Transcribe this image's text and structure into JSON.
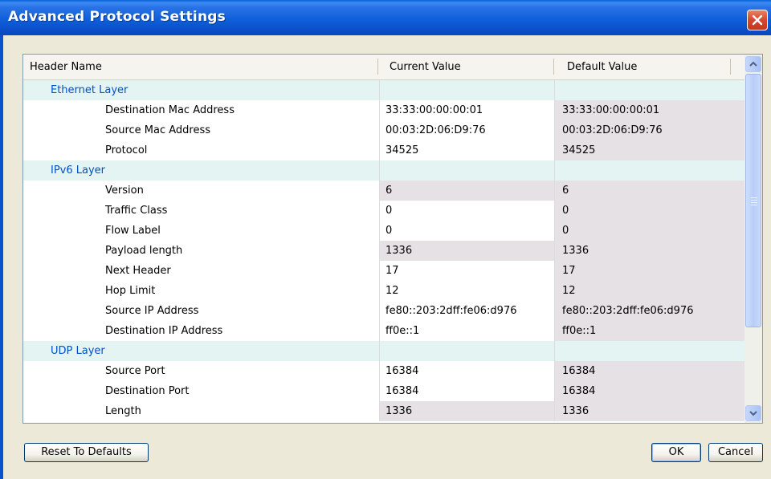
{
  "window": {
    "title": "Advanced Protocol Settings"
  },
  "grid": {
    "headers": [
      "Header Name",
      "Current Value",
      "Default Value"
    ],
    "rows": [
      {
        "section": true,
        "name": "Ethernet Layer",
        "current": "",
        "default": ""
      },
      {
        "section": false,
        "name": "Destination Mac Address",
        "current": "33:33:00:00:00:01",
        "default": "33:33:00:00:00:01"
      },
      {
        "section": false,
        "name": "Source Mac Address",
        "current": "00:03:2D:06:D9:76",
        "default": "00:03:2D:06:D9:76"
      },
      {
        "section": false,
        "name": "Protocol",
        "current": "34525",
        "default": "34525"
      },
      {
        "section": true,
        "name": "IPv6 Layer",
        "current": "",
        "default": ""
      },
      {
        "section": false,
        "name": "Version",
        "current": "6",
        "default": "6",
        "readonly": true
      },
      {
        "section": false,
        "name": "Traffic Class",
        "current": "0",
        "default": "0"
      },
      {
        "section": false,
        "name": "Flow Label",
        "current": "0",
        "default": "0"
      },
      {
        "section": false,
        "name": "Payload length",
        "current": "1336",
        "default": "1336",
        "readonly": true
      },
      {
        "section": false,
        "name": "Next Header",
        "current": "17",
        "default": "17"
      },
      {
        "section": false,
        "name": "Hop Limit",
        "current": "12",
        "default": "12"
      },
      {
        "section": false,
        "name": "Source IP Address",
        "current": "fe80::203:2dff:fe06:d976",
        "default": "fe80::203:2dff:fe06:d976"
      },
      {
        "section": false,
        "name": "Destination IP Address",
        "current": "ff0e::1",
        "default": "ff0e::1"
      },
      {
        "section": true,
        "name": "UDP Layer",
        "current": "",
        "default": ""
      },
      {
        "section": false,
        "name": "Source Port",
        "current": "16384",
        "default": "16384"
      },
      {
        "section": false,
        "name": "Destination Port",
        "current": "16384",
        "default": "16384"
      },
      {
        "section": false,
        "name": "Length",
        "current": "1336",
        "default": "1336",
        "readonly": true
      }
    ]
  },
  "buttons": {
    "reset": "Reset To Defaults",
    "ok": "OK",
    "cancel": "Cancel"
  },
  "icons": {
    "close": "close-icon",
    "scroll_up": "chevron-up-icon",
    "scroll_down": "chevron-down-icon"
  },
  "colors": {
    "title_bar": "#0a4fc8",
    "section_row": "#e3f4f3",
    "section_text": "#0050c8",
    "readonly_cell": "#e6e1e4",
    "close_button": "#d5482d"
  }
}
